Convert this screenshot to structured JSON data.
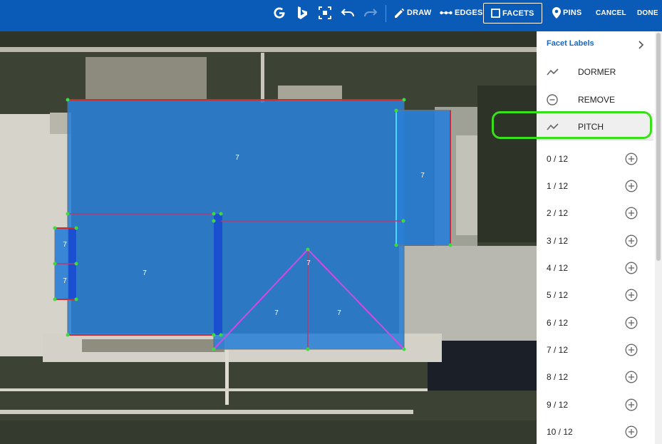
{
  "toolbar": {
    "draw": "DRAW",
    "edges": "EDGES",
    "facets": "FACETS",
    "pins": "PINS",
    "cancel": "CANCEL",
    "done": "DONE",
    "icons": [
      "google-icon",
      "bing-icon",
      "fit-view-icon",
      "undo-icon",
      "redo-icon",
      "pencil-icon",
      "edges-icon",
      "facets-icon",
      "pin-icon"
    ]
  },
  "panel": {
    "header": "Facet Labels",
    "menu": [
      {
        "label": "DORMER",
        "icon": "trend-icon"
      },
      {
        "label": "REMOVE",
        "icon": "minus-circle-icon"
      },
      {
        "label": "PITCH",
        "icon": "trend-icon",
        "selected": true
      }
    ],
    "pitches": [
      "0 / 12",
      "1 / 12",
      "2 / 12",
      "3 / 12",
      "4 / 12",
      "5 / 12",
      "6 / 12",
      "7 / 12",
      "8 / 12",
      "9 / 12",
      "10 / 12"
    ]
  },
  "facets": {
    "labels": [
      "7",
      "7",
      "7",
      "7",
      "7",
      "7",
      "7",
      "7"
    ]
  },
  "colors": {
    "topbar": "#0a5ab8",
    "facet_fill": "#2a7fd6",
    "highlight": "#38e01a",
    "ridge": "#d548e8",
    "eave": "#d02a2a",
    "vertex": "#3cdc3c"
  }
}
